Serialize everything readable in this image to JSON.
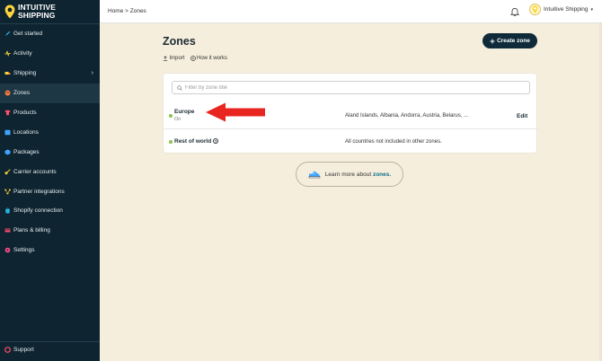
{
  "brand": {
    "line1": "INTUITIVE",
    "line2": "SHIPPING"
  },
  "sidebar": {
    "items": [
      {
        "label": "Get started",
        "icon": "rocket-icon",
        "color": "#27b3e6"
      },
      {
        "label": "Activity",
        "icon": "activity-icon",
        "color": "#ffd43b"
      },
      {
        "label": "Shipping",
        "icon": "truck-icon",
        "color": "#ffd43b",
        "chevron": "›"
      },
      {
        "label": "Zones",
        "icon": "globe-icon",
        "color": "#ff7a3d",
        "active": true
      },
      {
        "label": "Products",
        "icon": "shirt-icon",
        "color": "#ff4d6d"
      },
      {
        "label": "Locations",
        "icon": "location-icon",
        "color": "#3da5ff"
      },
      {
        "label": "Packages",
        "icon": "package-icon",
        "color": "#3da5ff"
      },
      {
        "label": "Carrier accounts",
        "icon": "key-icon",
        "color": "#ffd43b"
      },
      {
        "label": "Partner integrations",
        "icon": "network-icon",
        "color": "#ffd43b"
      },
      {
        "label": "Shopify connection",
        "icon": "shopify-icon",
        "color": "#27b3e6"
      },
      {
        "label": "Plans & billing",
        "icon": "card-icon",
        "color": "#ff4d6d"
      },
      {
        "label": "Settings",
        "icon": "gear-icon",
        "color": "#ff4d8a"
      }
    ],
    "support": {
      "label": "Support",
      "icon": "support-icon",
      "color": "#ff4d6d"
    }
  },
  "topbar": {
    "breadcrumb": "Home > Zones",
    "account_name": "Intuitive Shipping",
    "caret": "▾"
  },
  "main": {
    "title": "Zones",
    "create_button": "Create zone",
    "import_label": "Import",
    "how_label": "How it works",
    "search_placeholder": "Filter by zone title",
    "zones": [
      {
        "name": "Europe",
        "status": "On",
        "countries": "Aland Islands, Albania, Andorra, Austria, Belarus, ...",
        "action": "Edit"
      },
      {
        "name": "Rest of world",
        "info": "?",
        "countries": "All countries not included in other zones."
      }
    ],
    "learn_prefix": "Learn more about",
    "learn_link": "zones."
  },
  "colors": {
    "sidebar_bg": "#0e2430",
    "page_bg": "#f6eedd",
    "primary": "#0f2b3a",
    "status_on": "#8bc34a",
    "link": "#0b6f8a",
    "annotation_arrow": "#e8251f"
  }
}
